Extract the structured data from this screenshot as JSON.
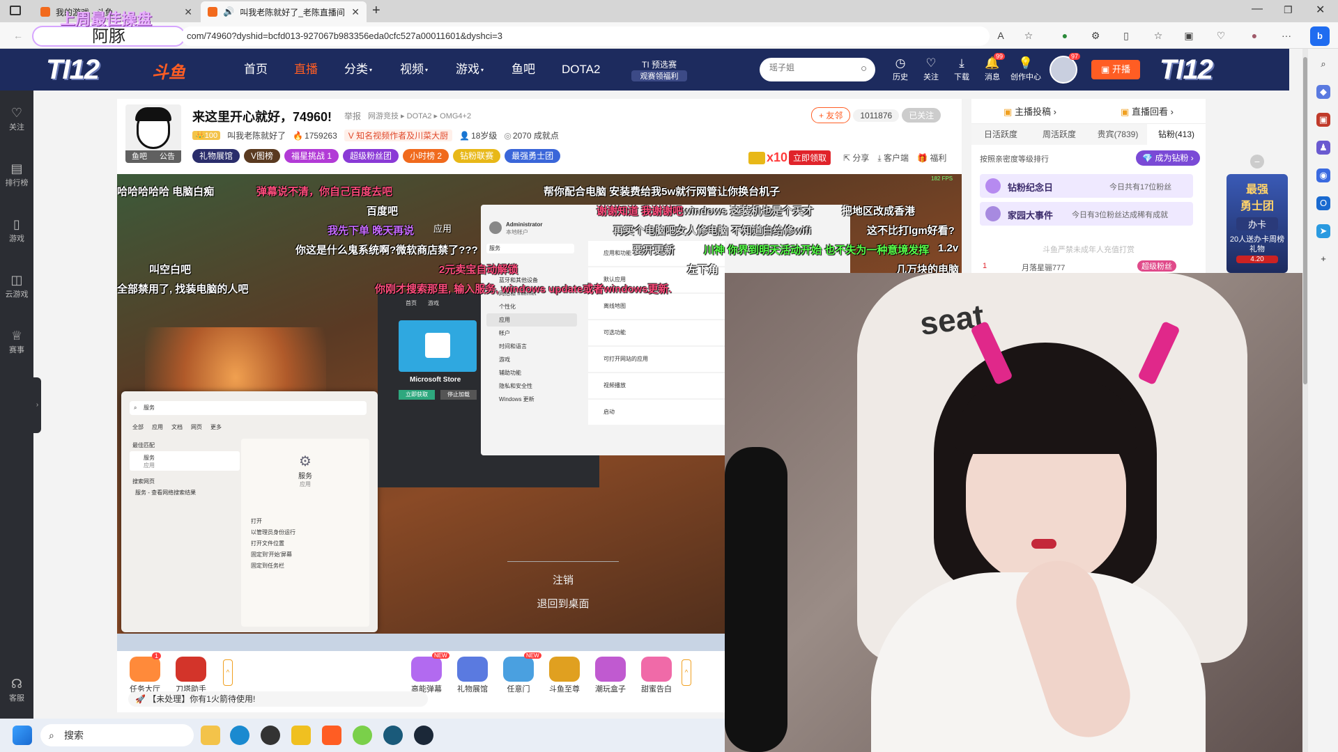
{
  "browser": {
    "tabs": [
      {
        "label": "我的游戏 - 斗鱼",
        "active": false
      },
      {
        "label": "叫我老陈就好了_老陈直播间",
        "active": true
      }
    ],
    "url": "com/74960?dyshid=bcfd013-927067b983356eda0cfc527a00011601&dyshci=3",
    "overlay_text_top": "上周最佳操盘",
    "overlay_text_name": "阿豚"
  },
  "header": {
    "logo_left": "TI12",
    "logo_brand": "斗鱼",
    "nav": [
      "首页",
      "直播",
      "分类",
      "视频",
      "游戏",
      "鱼吧",
      "DOTA2"
    ],
    "ti_promo_1": "TI 预选赛",
    "ti_promo_2": "观赛领福利",
    "search_placeholder": "瑶子姐",
    "icons": [
      {
        "label": "历史",
        "icon": "clock-icon"
      },
      {
        "label": "关注",
        "icon": "heart-icon"
      },
      {
        "label": "下载",
        "icon": "download-icon"
      },
      {
        "label": "消息",
        "icon": "bell-icon",
        "badge": "99"
      },
      {
        "label": "创作中心",
        "icon": "lightbulb-icon"
      }
    ],
    "avatar_badge": "97",
    "broadcast_label": "开播",
    "logo_right": "TI12"
  },
  "left_rail": [
    {
      "label": "关注",
      "icon": "heart-icon"
    },
    {
      "label": "排行榜",
      "icon": "rank-icon"
    },
    {
      "label": "游戏",
      "icon": "gamepad-icon"
    },
    {
      "label": "云游戏",
      "icon": "cloud-game-icon"
    },
    {
      "label": "赛事",
      "icon": "trophy-icon"
    },
    {
      "label": "客服",
      "icon": "headset-icon"
    }
  ],
  "room": {
    "title": "来这里开心就好，74960!",
    "report": "举报",
    "breadcrumb": [
      "网游竞技",
      "DOTA2",
      "OMG4+2"
    ],
    "anchor_level": "100",
    "anchor_name": "叫我老陈就好了",
    "hot": "1759263",
    "badge_text": "知名视频作者及川菜大厨",
    "age": "18岁级",
    "achievement": "2070 成就点",
    "avatar_label_1": "鱼吧",
    "avatar_label_2": "公告",
    "follow_btn": "友邻",
    "follow_count": "1011876",
    "followed": "已关注",
    "tags": [
      {
        "label": "礼物展馆",
        "color": "#2a2d6b"
      },
      {
        "label": "V图榜",
        "color": "#5a3a20"
      },
      {
        "label": "福星挑战 1",
        "color": "#b23bd6"
      },
      {
        "label": "超级粉丝团",
        "color": "#8a3ad6"
      },
      {
        "label": "小时榜 2",
        "color": "#f06a1d"
      },
      {
        "label": "钻粉联赛",
        "color": "#e8b818"
      },
      {
        "label": "最强勇士团",
        "color": "#3a66d9"
      }
    ],
    "reward_count": "x10",
    "reward_btn": "立即领取",
    "actions": [
      "分享",
      "客户端",
      "福利"
    ]
  },
  "danmu": [
    {
      "text": "哈哈哈哈哈 电脑白痴",
      "color": "#ffffff"
    },
    {
      "text": "弹幕说不清，你自己百度去吧",
      "color": "#ff4d7d"
    },
    {
      "text": "百度吧",
      "color": "#ffffff"
    },
    {
      "text": "我先下单 晚天再说",
      "color": "#c86bff"
    },
    {
      "text": "你这是什么鬼系统啊?微软商店禁了???",
      "color": "#ffffff"
    },
    {
      "text": "叫空白吧",
      "color": "#ffffff"
    },
    {
      "text": "全部禁用了, 找装电脑的人吧",
      "color": "#ffffff"
    },
    {
      "text": "你刚才搜索那里, 输入服务, windows update或者windows更新.",
      "color": "#ff4d7d"
    },
    {
      "text": "2元卖宝自动解锁",
      "color": "#ff4d7d"
    },
    {
      "text": "左下角",
      "color": "#ffffff"
    },
    {
      "text": "帮你配合电脑 安装费给我5w就行网管让你换台机子",
      "color": "#ffffff"
    },
    {
      "text": "谢谢知道 我谢谢吧",
      "color": "#ff4d7d"
    },
    {
      "text": "windows 这装机也是个天才",
      "color": "#dddddd"
    },
    {
      "text": "把地区改成香港",
      "color": "#ffffff"
    },
    {
      "text": "再买个电脑吧女人修电脑 不知道白给修wifi",
      "color": "#dddddd"
    },
    {
      "text": "这不比打lgm好看?",
      "color": "#ffffff"
    },
    {
      "text": "要开更新",
      "color": "#dddddd"
    },
    {
      "text": "川神 你界到明天活动开始 也不失为一种意境发挥",
      "color": "#58ff4a"
    },
    {
      "text": "1.2v",
      "color": "#ffffff"
    },
    {
      "text": "几万块的电脑",
      "color": "#ffffff"
    }
  ],
  "windows_ui": {
    "settings_user": "Administrator",
    "settings_sub": "本地帐户",
    "settings_search": "服务",
    "settings_title": "应用",
    "settings_menu": [
      "系统",
      "蓝牙和其他设备",
      "网络和 Internet",
      "个性化",
      "应用",
      "帐户",
      "时间和语言",
      "游戏",
      "辅助功能",
      "隐私和安全性",
      "Windows 更新"
    ],
    "settings_items": [
      "应用和功能",
      "默认应用",
      "离线地图",
      "可选功能",
      "可打开网站的应用",
      "视频播放",
      "启动"
    ],
    "store_name": "Microsoft Store",
    "store_btn_1": "立即获取",
    "store_btn_2": "停止加载",
    "store_nav": [
      "首页",
      "游戏"
    ],
    "search_query": "服务",
    "search_tabs": [
      "全部",
      "应用",
      "文档",
      "网页",
      "更多"
    ],
    "search_best": "最佳匹配",
    "search_result": "服务",
    "search_result_sub": "应用",
    "search_web": "搜索网页",
    "search_web_item": "服务 - 查看网络搜索结果",
    "search_preview_title": "服务",
    "search_preview_sub": "应用",
    "search_actions": [
      "打开",
      "以管理员身份运行",
      "打开文件位置",
      "固定到'开始'屏幕",
      "固定到任务栏"
    ],
    "menu_logout": "注销",
    "menu_desktop": "退回到桌面"
  },
  "right_panel": {
    "tabs_top": [
      "主播投稿",
      "直播回看"
    ],
    "rank_tabs": [
      "日活跃度",
      "周活跃度",
      "贵宾(7839)",
      "钻粉(413)"
    ],
    "rank_note": "按照亲密度等级排行",
    "diamond_btn": "成为钻粉",
    "event_1_title": "钻粉纪念日",
    "event_1_desc": "今日共有17位粉丝",
    "event_2_title": "家园大事件",
    "event_2_desc": "今日有3位粉丝达成稀有成就",
    "notice": "斗鱼严禁未成年人充值打赏",
    "rank_first_num": "1",
    "rank_first_name": "月落星骊777",
    "rank_first_badge": "超级粉丝"
  },
  "side_promo": {
    "title_1": "最强",
    "title_2": "勇士团",
    "action": "办卡",
    "desc": "20人送办卡周榜礼物",
    "value": "4.20"
  },
  "gift_bar": {
    "left_items": [
      {
        "label": "任务大厅",
        "badge": "1"
      },
      {
        "label": "刀塔助手",
        "badge": ""
      }
    ],
    "right_items": [
      {
        "label": "高能弹幕",
        "badge": "NEW"
      },
      {
        "label": "礼物展馆",
        "badge": ""
      },
      {
        "label": "任意门",
        "badge": "NEW"
      },
      {
        "label": "斗鱼至尊",
        "badge": ""
      },
      {
        "label": "潮玩盒子",
        "badge": ""
      },
      {
        "label": "甜蜜告白",
        "badge": ""
      }
    ],
    "notice": "【未处理】你有1火箭待使用!"
  },
  "taskbar": {
    "search": "搜索"
  },
  "stream_fps": "182 FPS",
  "colors": {
    "header_bg": "#1d2b5e",
    "accent_orange": "#ff5d23",
    "accent_purple": "#8a3ad6",
    "rail_bg": "#2b2d33"
  }
}
